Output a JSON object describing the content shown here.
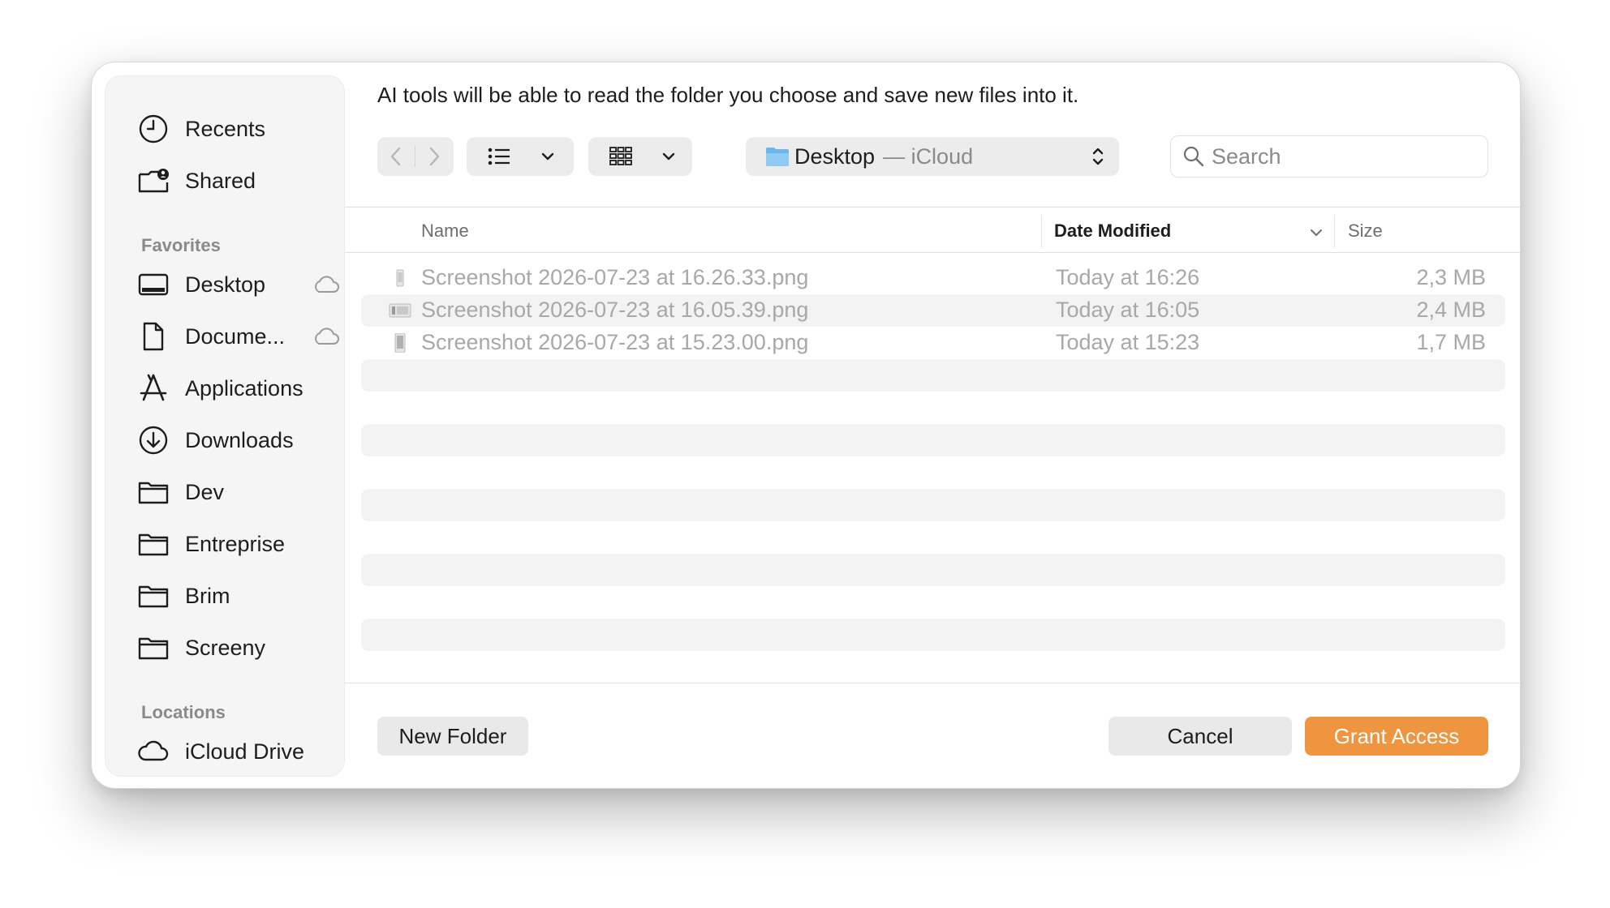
{
  "dialog": {
    "prompt": "AI tools will be able to read the folder you choose and save new files into it."
  },
  "sidebar": {
    "recents": "Recents",
    "shared": "Shared",
    "favorites_header": "Favorites",
    "favorites": [
      {
        "label": "Desktop",
        "icon": "desktop-icon",
        "icloud": true
      },
      {
        "label": "Docume...",
        "icon": "document-icon",
        "icloud": true
      },
      {
        "label": "Applications",
        "icon": "applications-icon",
        "icloud": false
      },
      {
        "label": "Downloads",
        "icon": "downloads-icon",
        "icloud": false
      },
      {
        "label": "Dev",
        "icon": "folder-icon",
        "icloud": false
      },
      {
        "label": "Entreprise",
        "icon": "folder-icon",
        "icloud": false
      },
      {
        "label": "Brim",
        "icon": "folder-icon",
        "icloud": false
      },
      {
        "label": "Screeny",
        "icon": "folder-icon",
        "icloud": false
      }
    ],
    "locations_header": "Locations",
    "locations": [
      {
        "label": "iCloud Drive",
        "icon": "cloud-icon"
      }
    ]
  },
  "toolbar": {
    "location": "Desktop",
    "location_sub": "— iCloud",
    "search_placeholder": "Search"
  },
  "columns": {
    "name": "Name",
    "date": "Date Modified",
    "size": "Size"
  },
  "files": [
    {
      "name": "Screenshot 2026-07-23 at 16.26.33.png",
      "date": "Today at 16:26",
      "size": "2,3 MB"
    },
    {
      "name": "Screenshot 2026-07-23 at 16.05.39.png",
      "date": "Today at 16:05",
      "size": "2,4 MB"
    },
    {
      "name": "Screenshot 2026-07-23 at 15.23.00.png",
      "date": "Today at 15:23",
      "size": "1,7 MB"
    }
  ],
  "footer": {
    "new_folder": "New Folder",
    "cancel": "Cancel",
    "grant": "Grant Access"
  },
  "colors": {
    "accent": "#f0953f",
    "folder_blue": "#6cb6ea"
  }
}
